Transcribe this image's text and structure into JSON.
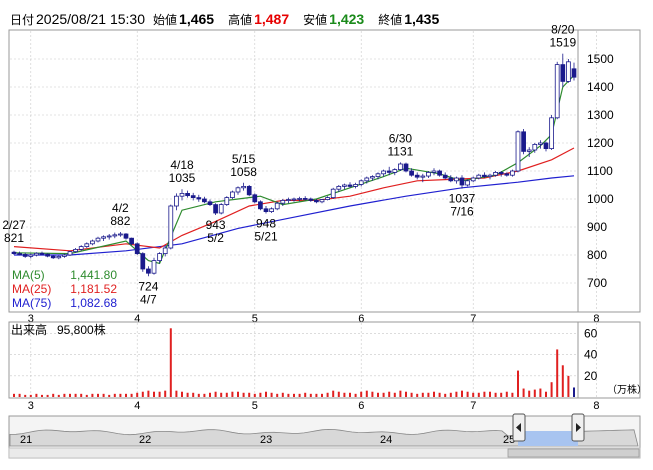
{
  "header": {
    "date_label": "日付",
    "date_value": "2025/08/21 15:30",
    "open_label": "始値",
    "open_value": "1,465",
    "high_label": "高値",
    "high_value": "1,487",
    "low_label": "安値",
    "low_value": "1,423",
    "close_label": "終値",
    "close_value": "1,435"
  },
  "legend": {
    "ma5_label": "MA(5)",
    "ma5_value": "1,441.80",
    "ma25_label": "MA(25)",
    "ma25_value": "1,181.52",
    "ma75_label": "MA(75)",
    "ma75_value": "1,082.68"
  },
  "volume_panel": {
    "label": "出来高",
    "value": "95,800株",
    "unit": "（万株）"
  },
  "colors": {
    "up_candle": "#ffffff",
    "down_candle": "#1a1a8c",
    "ma5": "#2e8b2e",
    "ma25": "#e02020",
    "ma75": "#2020d0",
    "volume": "#e02020",
    "grid": "#c8c8c8",
    "nav_fill": "#a8c4f0"
  },
  "icons": {
    "nav_left": "left-scroll-handle-icon",
    "nav_right": "right-scroll-handle-icon"
  },
  "nav": {
    "labels": [
      "21",
      "22",
      "23",
      "24",
      "25"
    ]
  },
  "chart_data": [
    {
      "type": "candlestick",
      "ylim": [
        600,
        1600
      ],
      "yticks": [
        700,
        800,
        900,
        1000,
        1100,
        1200,
        1300,
        1400,
        1500
      ],
      "month_labels": [
        "3",
        "4",
        "5",
        "6",
        "7",
        "8"
      ],
      "month_positions": [
        3,
        22,
        43,
        62,
        82,
        104
      ],
      "candles": [
        [
          0,
          810,
          815,
          800,
          805
        ],
        [
          1,
          805,
          812,
          798,
          802
        ],
        [
          2,
          802,
          808,
          790,
          795
        ],
        [
          3,
          795,
          805,
          788,
          800
        ],
        [
          4,
          800,
          810,
          795,
          806
        ],
        [
          5,
          806,
          812,
          800,
          803
        ],
        [
          6,
          803,
          806,
          792,
          796
        ],
        [
          7,
          796,
          800,
          786,
          790
        ],
        [
          8,
          790,
          798,
          785,
          795
        ],
        [
          9,
          795,
          805,
          790,
          800
        ],
        [
          10,
          800,
          815,
          797,
          812
        ],
        [
          11,
          812,
          825,
          808,
          820
        ],
        [
          12,
          820,
          835,
          815,
          830
        ],
        [
          13,
          830,
          845,
          825,
          840
        ],
        [
          14,
          840,
          855,
          835,
          850
        ],
        [
          15,
          850,
          865,
          845,
          860
        ],
        [
          16,
          860,
          870,
          850,
          865
        ],
        [
          17,
          865,
          875,
          855,
          868
        ],
        [
          18,
          868,
          880,
          860,
          872
        ],
        [
          19,
          872,
          882,
          865,
          875
        ],
        [
          20,
          875,
          878,
          855,
          860
        ],
        [
          21,
          860,
          862,
          835,
          840
        ],
        [
          22,
          840,
          845,
          800,
          805
        ],
        [
          23,
          805,
          810,
          740,
          750
        ],
        [
          24,
          750,
          760,
          724,
          735
        ],
        [
          25,
          735,
          790,
          730,
          780
        ],
        [
          26,
          780,
          810,
          770,
          805
        ],
        [
          27,
          805,
          830,
          795,
          825
        ],
        [
          28,
          825,
          980,
          820,
          975
        ],
        [
          29,
          975,
          1020,
          960,
          1010
        ],
        [
          30,
          1010,
          1035,
          995,
          1020
        ],
        [
          31,
          1020,
          1030,
          1005,
          1012
        ],
        [
          32,
          1012,
          1022,
          995,
          1005
        ],
        [
          33,
          1005,
          1015,
          990,
          1000
        ],
        [
          34,
          1000,
          1008,
          985,
          990
        ],
        [
          35,
          990,
          998,
          975,
          980
        ],
        [
          36,
          980,
          985,
          943,
          950
        ],
        [
          37,
          950,
          985,
          945,
          980
        ],
        [
          38,
          980,
          1010,
          975,
          1005
        ],
        [
          39,
          1005,
          1030,
          1000,
          1025
        ],
        [
          40,
          1025,
          1045,
          1015,
          1040
        ],
        [
          41,
          1040,
          1058,
          1030,
          1045
        ],
        [
          42,
          1045,
          1050,
          1010,
          1015
        ],
        [
          43,
          1015,
          1020,
          985,
          990
        ],
        [
          44,
          990,
          995,
          960,
          965
        ],
        [
          45,
          965,
          975,
          948,
          955
        ],
        [
          46,
          955,
          970,
          950,
          965
        ],
        [
          47,
          965,
          990,
          960,
          985
        ],
        [
          48,
          985,
          1000,
          975,
          995
        ],
        [
          49,
          995,
          1005,
          985,
          998
        ],
        [
          50,
          998,
          1005,
          990,
          1000
        ],
        [
          51,
          1000,
          1008,
          992,
          1002
        ],
        [
          52,
          1002,
          1010,
          995,
          1000
        ],
        [
          53,
          1000,
          1005,
          990,
          995
        ],
        [
          54,
          995,
          1000,
          985,
          990
        ],
        [
          55,
          990,
          1000,
          985,
          998
        ],
        [
          56,
          998,
          1010,
          995,
          1005
        ],
        [
          57,
          1005,
          1040,
          1000,
          1035
        ],
        [
          58,
          1035,
          1050,
          1025,
          1045
        ],
        [
          59,
          1045,
          1055,
          1035,
          1050
        ],
        [
          60,
          1050,
          1060,
          1040,
          1045
        ],
        [
          61,
          1045,
          1058,
          1038,
          1052
        ],
        [
          62,
          1052,
          1070,
          1045,
          1065
        ],
        [
          63,
          1065,
          1080,
          1055,
          1075
        ],
        [
          64,
          1075,
          1085,
          1065,
          1080
        ],
        [
          65,
          1080,
          1095,
          1070,
          1090
        ],
        [
          66,
          1090,
          1105,
          1080,
          1100
        ],
        [
          67,
          1100,
          1115,
          1085,
          1095
        ],
        [
          68,
          1095,
          1110,
          1085,
          1105
        ],
        [
          69,
          1105,
          1131,
          1100,
          1125
        ],
        [
          70,
          1125,
          1130,
          1095,
          1100
        ],
        [
          71,
          1100,
          1110,
          1080,
          1085
        ],
        [
          72,
          1085,
          1095,
          1070,
          1078
        ],
        [
          73,
          1078,
          1090,
          1060,
          1082
        ],
        [
          74,
          1082,
          1100,
          1075,
          1095
        ],
        [
          75,
          1095,
          1110,
          1085,
          1100
        ],
        [
          76,
          1100,
          1105,
          1080,
          1085
        ],
        [
          77,
          1085,
          1095,
          1070,
          1075
        ],
        [
          78,
          1075,
          1085,
          1060,
          1065
        ],
        [
          79,
          1065,
          1080,
          1055,
          1075
        ],
        [
          80,
          1075,
          1085,
          1037,
          1050
        ],
        [
          81,
          1050,
          1070,
          1045,
          1065
        ],
        [
          82,
          1065,
          1080,
          1060,
          1075
        ],
        [
          83,
          1075,
          1090,
          1070,
          1085
        ],
        [
          84,
          1085,
          1095,
          1075,
          1080
        ],
        [
          85,
          1080,
          1090,
          1070,
          1085
        ],
        [
          86,
          1085,
          1100,
          1080,
          1095
        ],
        [
          87,
          1095,
          1100,
          1080,
          1090
        ],
        [
          88,
          1090,
          1095,
          1080,
          1085
        ],
        [
          89,
          1085,
          1105,
          1080,
          1100
        ],
        [
          90,
          1100,
          1245,
          1095,
          1240
        ],
        [
          91,
          1240,
          1250,
          1160,
          1170
        ],
        [
          92,
          1170,
          1185,
          1150,
          1175
        ],
        [
          93,
          1175,
          1200,
          1165,
          1195
        ],
        [
          94,
          1195,
          1210,
          1180,
          1200
        ],
        [
          95,
          1200,
          1205,
          1170,
          1180
        ],
        [
          96,
          1180,
          1300,
          1175,
          1290
        ],
        [
          97,
          1290,
          1490,
          1285,
          1480
        ],
        [
          98,
          1480,
          1519,
          1400,
          1420
        ],
        [
          99,
          1420,
          1500,
          1415,
          1490
        ],
        [
          100,
          1465,
          1487,
          1423,
          1435
        ]
      ],
      "ma5": [
        [
          0,
          808
        ],
        [
          10,
          805
        ],
        [
          20,
          850
        ],
        [
          24,
          780
        ],
        [
          26,
          770
        ],
        [
          30,
          960
        ],
        [
          36,
          990
        ],
        [
          40,
          1000
        ],
        [
          44,
          1010
        ],
        [
          48,
          980
        ],
        [
          54,
          1000
        ],
        [
          60,
          1040
        ],
        [
          66,
          1080
        ],
        [
          70,
          1110
        ],
        [
          76,
          1090
        ],
        [
          80,
          1065
        ],
        [
          86,
          1085
        ],
        [
          90,
          1130
        ],
        [
          94,
          1190
        ],
        [
          96,
          1230
        ],
        [
          98,
          1400
        ],
        [
          100,
          1442
        ]
      ],
      "ma25": [
        [
          0,
          830
        ],
        [
          10,
          815
        ],
        [
          20,
          840
        ],
        [
          26,
          825
        ],
        [
          30,
          870
        ],
        [
          36,
          920
        ],
        [
          42,
          975
        ],
        [
          48,
          995
        ],
        [
          54,
          995
        ],
        [
          60,
          1010
        ],
        [
          66,
          1040
        ],
        [
          72,
          1065
        ],
        [
          78,
          1070
        ],
        [
          84,
          1075
        ],
        [
          90,
          1100
        ],
        [
          96,
          1140
        ],
        [
          100,
          1182
        ]
      ],
      "ma75": [
        [
          0,
          800
        ],
        [
          10,
          800
        ],
        [
          20,
          815
        ],
        [
          30,
          840
        ],
        [
          40,
          895
        ],
        [
          50,
          935
        ],
        [
          60,
          975
        ],
        [
          70,
          1010
        ],
        [
          80,
          1040
        ],
        [
          90,
          1060
        ],
        [
          96,
          1075
        ],
        [
          100,
          1083
        ]
      ],
      "annotations": [
        {
          "label": "2/27",
          "sub": "821",
          "i": 0,
          "price": 821,
          "pos": "above"
        },
        {
          "label": "4/2",
          "sub": "882",
          "i": 19,
          "price": 882,
          "pos": "above"
        },
        {
          "label": "724",
          "sub": "4/7",
          "i": 24,
          "price": 724,
          "pos": "below"
        },
        {
          "label": "4/18",
          "sub": "1035",
          "i": 30,
          "price": 1035,
          "pos": "above"
        },
        {
          "label": "943",
          "sub": "5/2",
          "i": 36,
          "price": 943,
          "pos": "below"
        },
        {
          "label": "5/15",
          "sub": "1058",
          "i": 41,
          "price": 1058,
          "pos": "above"
        },
        {
          "label": "948",
          "sub": "5/21",
          "i": 45,
          "price": 948,
          "pos": "below"
        },
        {
          "label": "6/30",
          "sub": "1131",
          "i": 69,
          "price": 1131,
          "pos": "above"
        },
        {
          "label": "1037",
          "sub": "7/16",
          "i": 80,
          "price": 1037,
          "pos": "below"
        },
        {
          "label": "8/20",
          "sub": "1519",
          "i": 98,
          "price": 1519,
          "pos": "above"
        }
      ]
    },
    {
      "type": "bar",
      "ylim": [
        0,
        70
      ],
      "yticks": [
        20,
        40,
        60
      ],
      "values": [
        3,
        3,
        2,
        2,
        3,
        2,
        2,
        3,
        2,
        3,
        3,
        3,
        3,
        2,
        3,
        3,
        3,
        2,
        3,
        3,
        3,
        3,
        4,
        5,
        6,
        5,
        5,
        6,
        65,
        6,
        5,
        4,
        4,
        3,
        3,
        4,
        5,
        4,
        4,
        5,
        5,
        4,
        4,
        3,
        4,
        5,
        4,
        3,
        4,
        3,
        3,
        3,
        4,
        3,
        3,
        3,
        4,
        6,
        5,
        4,
        4,
        3,
        5,
        6,
        5,
        4,
        4,
        5,
        4,
        6,
        5,
        4,
        3,
        4,
        4,
        5,
        4,
        3,
        4,
        5,
        6,
        5,
        4,
        4,
        5,
        5,
        4,
        4,
        5,
        4,
        25,
        8,
        6,
        7,
        8,
        5,
        14,
        45,
        30,
        20,
        9
      ]
    }
  ]
}
